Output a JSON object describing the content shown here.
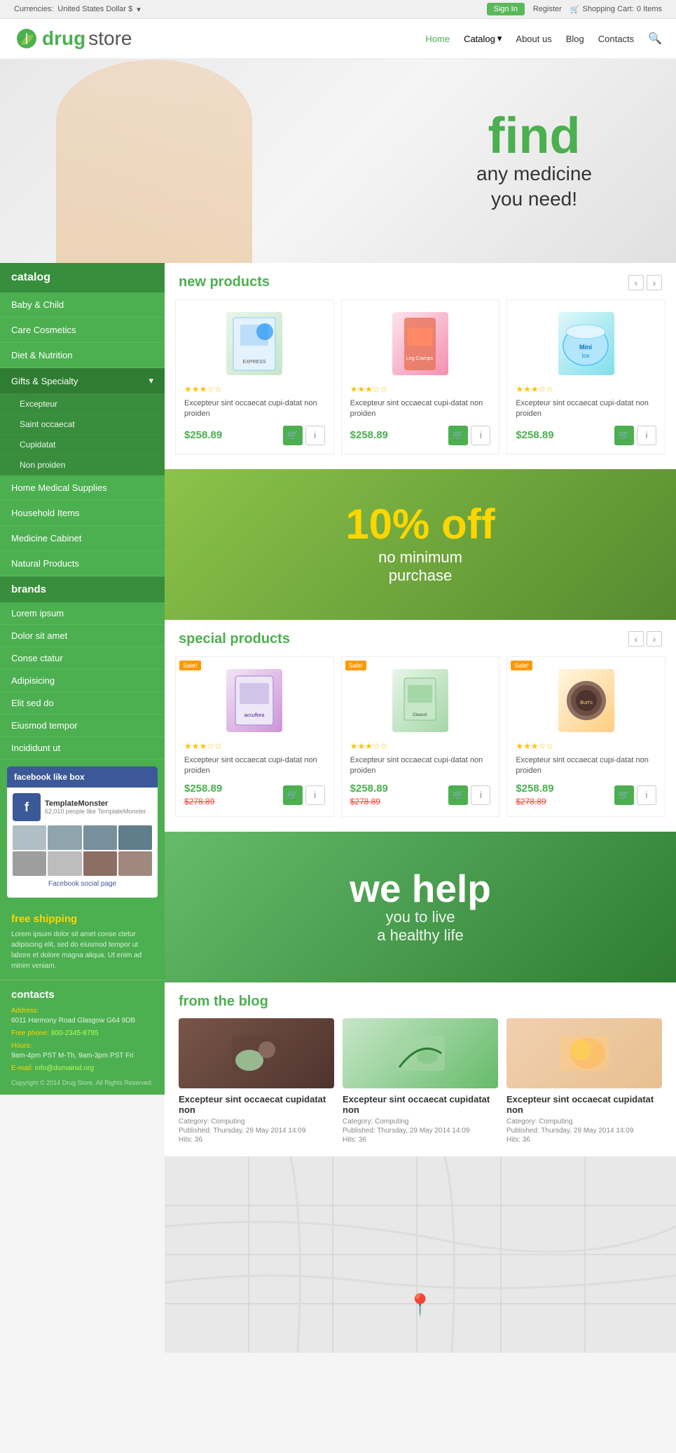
{
  "topbar": {
    "currency_label": "Currencies:",
    "currency_value": "United States Dollar $",
    "signin": "Sign In",
    "register": "Register",
    "cart_label": "Shopping Cart:",
    "cart_count": "0 Items"
  },
  "header": {
    "logo_drug": "drug",
    "logo_store": "store",
    "nav": {
      "home": "Home",
      "catalog": "Catalog",
      "about": "About us",
      "blog": "Blog",
      "contacts": "Contacts"
    }
  },
  "hero": {
    "find": "find",
    "line1": "any medicine",
    "line2": "you need!"
  },
  "sidebar": {
    "catalog_title": "catalog",
    "items": [
      {
        "label": "Baby & Child",
        "has_sub": false
      },
      {
        "label": "Care Cosmetics",
        "has_sub": false
      },
      {
        "label": "Diet & Nutrition",
        "has_sub": false
      },
      {
        "label": "Gifts & Specialty",
        "has_sub": true
      },
      {
        "label": "Home Medical Supplies",
        "has_sub": false
      },
      {
        "label": "Household Items",
        "has_sub": false
      },
      {
        "label": "Medicine Cabinet",
        "has_sub": false
      },
      {
        "label": "Natural Products",
        "has_sub": false
      }
    ],
    "subitems": [
      "Excepteur",
      "Saint occaecat",
      "Cupidatat",
      "Non proiden"
    ],
    "brands_title": "brands",
    "brands": [
      "Lorem ipsum",
      "Dolor sit amet",
      "Conse ctatur",
      "Adipisicing",
      "Elit sed do",
      "Eiusmod tempor",
      "Incididunt ut"
    ],
    "fb_title": "facebook like box",
    "fb_page_name": "TemplateMonster",
    "fb_likes": "62,010 people like TemplateMonster",
    "fb_link": "Facebook social page",
    "free_shipping_title": "free shipping",
    "free_shipping_text": "Lorem ipsum dolor sit amet conse ctetur adipiscing elit, sed do eiusmod tempor ut labore et dolore magna aliqua. Ut enim ad minim veniam.",
    "contacts_title": "contacts",
    "address_label": "Address:",
    "address_value": "6011 Harmony Road Glasgow G64 9DB",
    "phone_label": "Free phone:",
    "phone_value": "800-2345-8795",
    "hours_label": "Hours:",
    "hours_value": "9am-4pm PST M-Th, 9am-3pm PST Fri",
    "email_label": "E-mail:",
    "email_value": "info@domainid.org",
    "copyright": "Copyright © 2014 Drug Store. All Rights Reserved."
  },
  "new_products": {
    "section_prefix": "new",
    "section_title": "products",
    "items": [
      {
        "name": "Excepteur sint occaecat cupi-datat non proiden",
        "price": "$258.89",
        "stars": 3
      },
      {
        "name": "Excepteur sint occaecat cupi-datat non proiden",
        "price": "$258.89",
        "stars": 3
      },
      {
        "name": "Excepteur sint occaecat cupi-datat non proiden",
        "price": "$258.89",
        "stars": 3
      }
    ]
  },
  "promo1": {
    "percent": "10% off",
    "line1": "no minimum",
    "line2": "purchase"
  },
  "special_products": {
    "section_prefix": "special",
    "section_title": "products",
    "items": [
      {
        "name": "Excepteur sint occaecat cupi-datat non proiden",
        "price": "$258.89",
        "old_price": "$278.89",
        "stars": 3,
        "sale": true
      },
      {
        "name": "Excepteur sint occaecat cupi-datat non proiden",
        "price": "$258.89",
        "old_price": "$278.89",
        "stars": 3,
        "sale": true
      },
      {
        "name": "Excepteur sint occaecat cupi-datat non proiden",
        "price": "$258.89",
        "old_price": "$278.89",
        "stars": 3,
        "sale": true
      }
    ]
  },
  "promo2": {
    "line1": "we help",
    "line2": "you to live",
    "line3": "a healthy life"
  },
  "blog": {
    "section_prefix": "from",
    "section_title": "the blog",
    "items": [
      {
        "title": "Excepteur sint occaecat cupidatat non",
        "category": "Category: Computing",
        "published": "Published: Thursday, 29 May 2014 14:09",
        "hits": "Hits: 36"
      },
      {
        "title": "Excepteur sint occaecat cupidatat non",
        "category": "Category: Computing",
        "published": "Published: Thursday, 29 May 2014 14:09",
        "hits": "Hits: 36"
      },
      {
        "title": "Excepteur sint occaecat cupidatat non",
        "category": "Category: Computing",
        "published": "Published: Thursday, 29 May 2014 14:09",
        "hits": "Hits: 36"
      }
    ]
  },
  "icons": {
    "cart": "🛒",
    "info": "i",
    "chevron_down": "▾",
    "chevron_left": "‹",
    "chevron_right": "›",
    "search": "🔍",
    "fb": "f",
    "map_pin": "📍",
    "star_filled": "★",
    "star_empty": "☆",
    "dropdown": "▾"
  },
  "colors": {
    "green": "#4caf50",
    "dark_green": "#388e3c",
    "yellow": "#ffd600",
    "orange": "#ff9800",
    "red": "#f44336"
  }
}
